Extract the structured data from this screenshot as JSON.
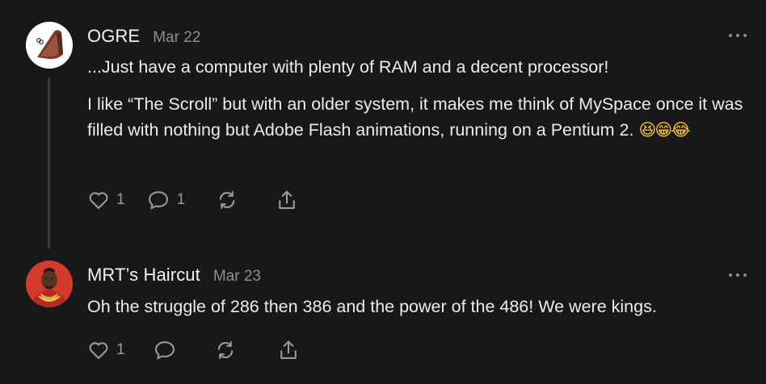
{
  "comments": [
    {
      "author": "OGRE",
      "date": "Mar 22",
      "paragraphs": [
        "...Just have a computer with plenty of RAM and a decent processor!",
        "I like “The Scroll” but with an older system, it makes me think of MySpace once it was filled with nothing but Adobe Flash animations, running on a Pentium 2. "
      ],
      "emojis": "😆😁😂",
      "like_count": "1",
      "reply_count": "1",
      "icons": [
        "heart-icon",
        "comment-icon",
        "restack-icon",
        "share-icon",
        "more-icon"
      ]
    },
    {
      "author": "MRT’s Haircut",
      "date": "Mar 23",
      "paragraphs": [
        "Oh the struggle of 286 then 386 and the power of the 486! We were kings."
      ],
      "like_count": "1",
      "icons": [
        "heart-icon",
        "comment-icon",
        "restack-icon",
        "share-icon",
        "more-icon"
      ]
    }
  ],
  "colors": {
    "background": "#18181a",
    "text": "#ececec",
    "muted": "#8e8e93",
    "thread_line": "#3a3a3c"
  }
}
